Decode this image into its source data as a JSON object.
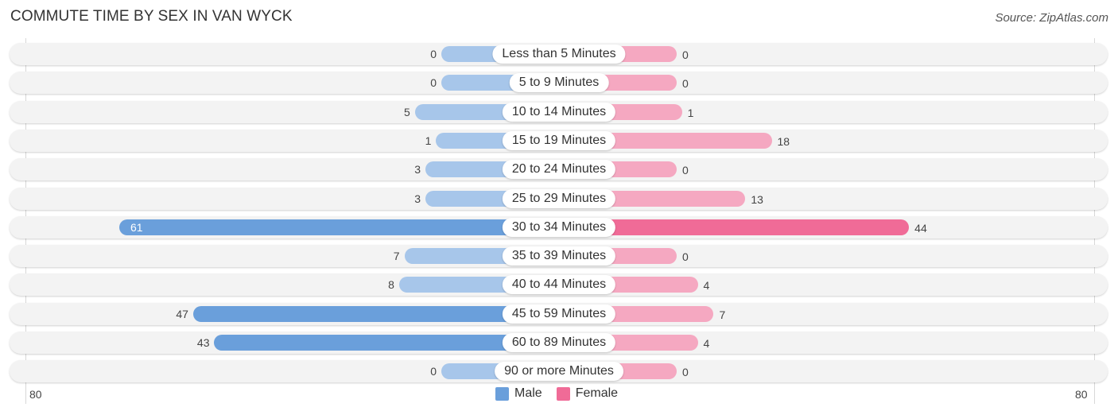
{
  "title": "COMMUTE TIME BY SEX IN VAN WYCK",
  "source": "Source: ZipAtlas.com",
  "colors": {
    "male": "#6a9fdb",
    "female": "#f06b97",
    "male_light": "#a7c6ea",
    "female_light": "#f5a8c1"
  },
  "chart_data": {
    "type": "bar",
    "orientation": "horizontal-diverging",
    "title": "COMMUTE TIME BY SEX IN VAN WYCK",
    "categories": [
      "Less than 5 Minutes",
      "5 to 9 Minutes",
      "10 to 14 Minutes",
      "15 to 19 Minutes",
      "20 to 24 Minutes",
      "25 to 29 Minutes",
      "30 to 34 Minutes",
      "35 to 39 Minutes",
      "40 to 44 Minutes",
      "45 to 59 Minutes",
      "60 to 89 Minutes",
      "90 or more Minutes"
    ],
    "series": [
      {
        "name": "Male",
        "values": [
          0,
          0,
          5,
          1,
          3,
          3,
          61,
          7,
          8,
          47,
          43,
          0
        ]
      },
      {
        "name": "Female",
        "values": [
          0,
          0,
          1,
          18,
          0,
          13,
          44,
          0,
          4,
          7,
          4,
          0
        ]
      }
    ],
    "axis": {
      "left_label": "80",
      "right_label": "80",
      "range": [
        -80,
        80
      ]
    },
    "legend": {
      "position": "bottom-center",
      "entries": [
        "Male",
        "Female"
      ]
    }
  }
}
